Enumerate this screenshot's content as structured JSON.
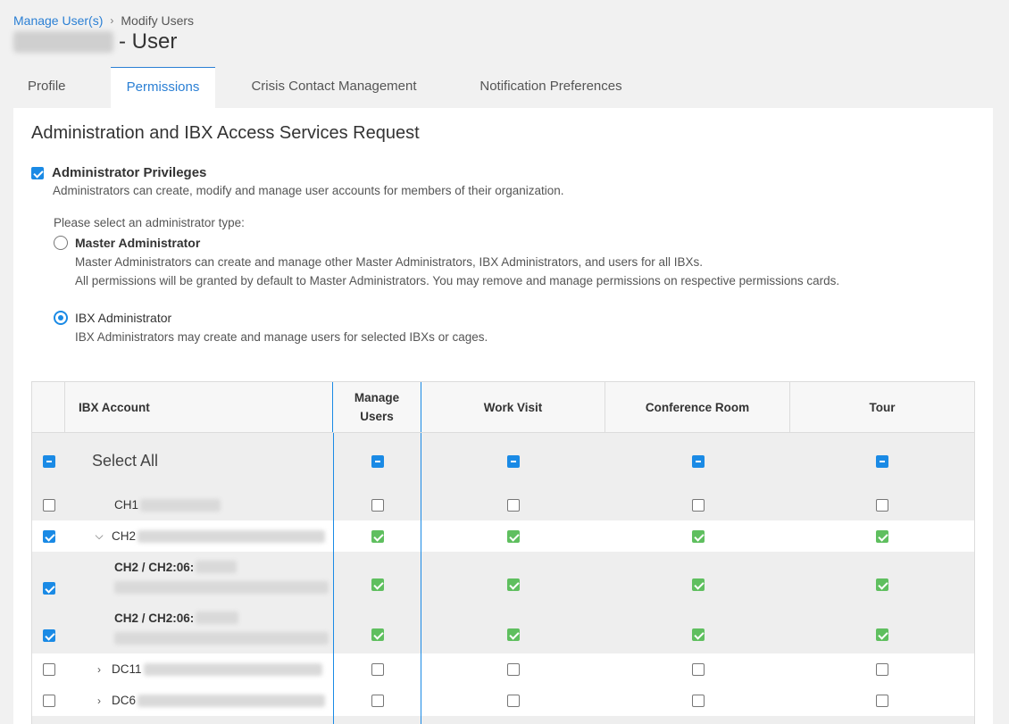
{
  "breadcrumb": {
    "parent": "Manage User(s)",
    "separator": "›",
    "current": "Modify Users"
  },
  "page": {
    "title_suffix": "- User"
  },
  "tabs": [
    {
      "label": "Profile",
      "active": false
    },
    {
      "label": "Permissions",
      "active": true
    },
    {
      "label": "Crisis Contact Management",
      "active": false
    },
    {
      "label": "Notification Preferences",
      "active": false
    }
  ],
  "section": {
    "title": "Administration and IBX Access Services Request",
    "admin_privileges": {
      "label": "Administrator Privileges",
      "checked": true,
      "description": "Administrators can create, modify and manage user accounts for members of their organization."
    },
    "admin_type_prompt": "Please select an administrator type:",
    "options": [
      {
        "label": "Master Administrator",
        "selected": false,
        "desc_line1": "Master Administrators can create and manage other Master Administrators, IBX Administrators, and users for all IBXs.",
        "desc_line2": "All permissions will be granted by default to Master Administrators. You may remove and manage permissions on respective permissions cards."
      },
      {
        "label": "IBX Administrator",
        "selected": true,
        "desc_line1": "IBX Administrators may create and manage users for selected IBXs or cages."
      }
    ]
  },
  "table": {
    "headers": {
      "account": "IBX Account",
      "manage_users_1": "Manage",
      "manage_users_2": "Users",
      "work_visit": "Work Visit",
      "conference_room": "Conference Room",
      "tour": "Tour"
    },
    "select_all": "Select All",
    "rows": [
      {
        "code": "CH1",
        "checked": false,
        "state": "unchecked"
      },
      {
        "code": "CH2",
        "checked": true,
        "state": "green",
        "expanded": true
      },
      {
        "code": "CH2 / CH2:06:",
        "checked": true,
        "state": "green"
      },
      {
        "code": "CH2 / CH2:06:",
        "checked": true,
        "state": "green"
      },
      {
        "code": "DC11",
        "checked": false,
        "state": "unchecked",
        "expanded": false
      },
      {
        "code": "DC6",
        "checked": false,
        "state": "unchecked",
        "expanded": false
      }
    ],
    "colors": {
      "accent": "#1a8ae5",
      "granted": "#5fbf5f"
    }
  }
}
